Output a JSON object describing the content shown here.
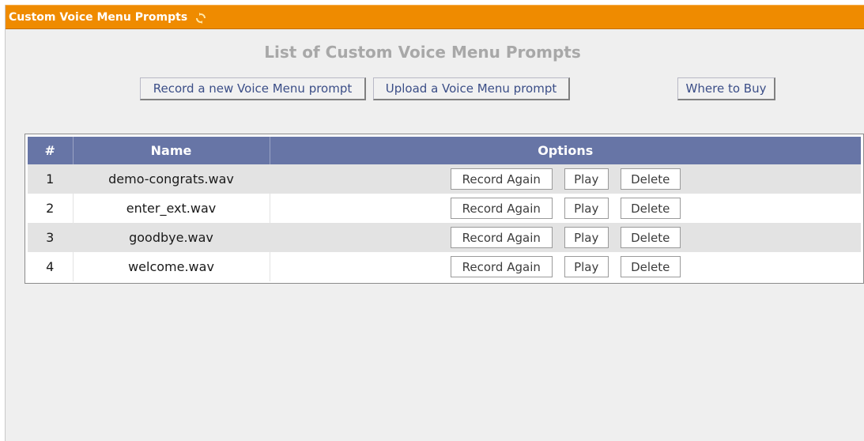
{
  "header": {
    "title": "Custom Voice Menu Prompts",
    "refresh_icon": "refresh-icon"
  },
  "main": {
    "heading": "List of Custom Voice Menu Prompts",
    "buttons": {
      "record_new": "Record a new Voice Menu prompt",
      "upload": "Upload a Voice Menu prompt",
      "where_to_buy": "Where to Buy"
    }
  },
  "table": {
    "columns": [
      "#",
      "Name",
      "Options"
    ],
    "rows": [
      {
        "num": "1",
        "name": "demo-congrats.wav"
      },
      {
        "num": "2",
        "name": "enter_ext.wav"
      },
      {
        "num": "3",
        "name": "goodbye.wav"
      },
      {
        "num": "4",
        "name": "welcome.wav"
      }
    ],
    "row_actions": {
      "record_again": "Record Again",
      "play": "Play",
      "delete": "Delete"
    }
  },
  "colors": {
    "title_bar": "#ef8b00",
    "table_header": "#6775a6",
    "button_text": "#3b4e87"
  }
}
